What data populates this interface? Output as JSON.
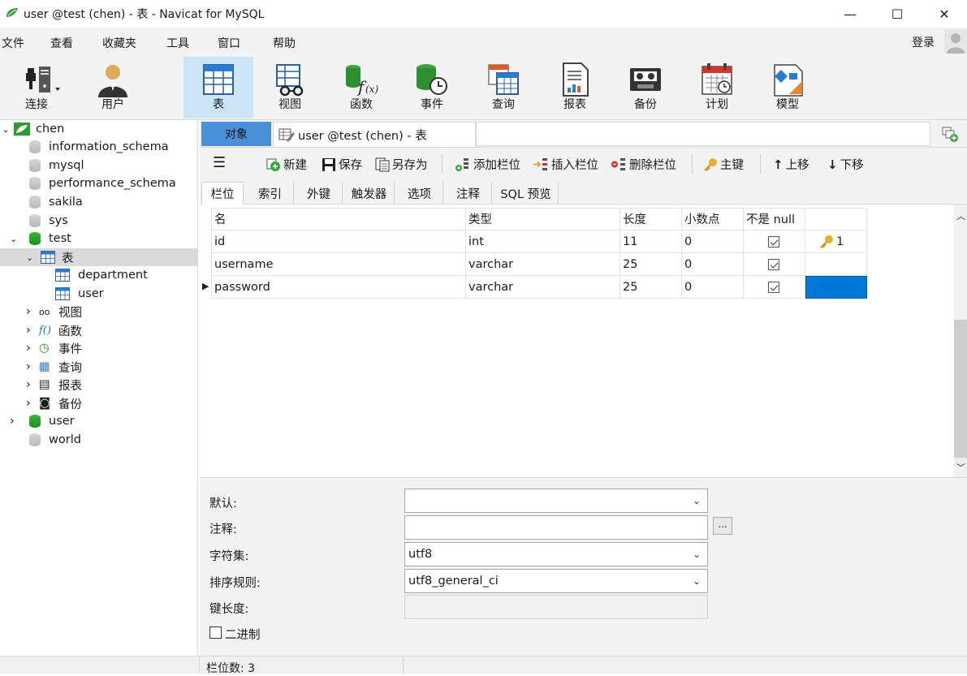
{
  "window": {
    "title": "user @test (chen) - 表 - Navicat for MySQL",
    "minimize_glyph": "—",
    "maximize_glyph": "☐",
    "close_glyph": "✕"
  },
  "menu": {
    "items": [
      "文件",
      "查看",
      "收藏夹",
      "工具",
      "窗口",
      "帮助"
    ],
    "login": "登录"
  },
  "ribbon": {
    "buttons": [
      {
        "label": "连接",
        "icon": "connection-icon"
      },
      {
        "label": "用户",
        "icon": "user-icon"
      },
      {
        "label": "表",
        "icon": "table-icon",
        "active": true
      },
      {
        "label": "视图",
        "icon": "view-icon"
      },
      {
        "label": "函数",
        "icon": "function-icon"
      },
      {
        "label": "事件",
        "icon": "event-icon"
      },
      {
        "label": "查询",
        "icon": "query-icon"
      },
      {
        "label": "报表",
        "icon": "report-icon"
      },
      {
        "label": "备份",
        "icon": "backup-icon"
      },
      {
        "label": "计划",
        "icon": "schedule-icon"
      },
      {
        "label": "模型",
        "icon": "model-icon"
      }
    ]
  },
  "tree": {
    "connection": "chen",
    "databases": [
      "information_schema",
      "mysql",
      "performance_schema",
      "sakila",
      "sys"
    ],
    "test_db": "test",
    "tables_node": "表",
    "tables": [
      "department",
      "user"
    ],
    "categories": [
      "视图",
      "函数",
      "事件",
      "查询",
      "报表",
      "备份"
    ],
    "user_db": "user",
    "world_db": "world"
  },
  "tabs": {
    "objects": "对象",
    "document": "user @test (chen) - 表"
  },
  "toolbar": {
    "new": "新建",
    "save": "保存",
    "save_as": "另存为",
    "add_field": "添加栏位",
    "insert_field": "插入栏位",
    "delete_field": "删除栏位",
    "primary_key": "主键",
    "move_up": "上移",
    "move_down": "下移"
  },
  "subtabs": [
    "栏位",
    "索引",
    "外键",
    "触发器",
    "选项",
    "注释",
    "SQL 预览"
  ],
  "grid": {
    "headers": [
      "名",
      "类型",
      "长度",
      "小数点",
      "不是 null",
      ""
    ],
    "rows": [
      {
        "name": "id",
        "type": "int",
        "length": "11",
        "decimals": "0",
        "not_null": true,
        "key": "1"
      },
      {
        "name": "username",
        "type": "varchar",
        "length": "25",
        "decimals": "0",
        "not_null": true,
        "key": ""
      },
      {
        "name": "password",
        "type": "varchar",
        "length": "25",
        "decimals": "0",
        "not_null": true,
        "key": ""
      }
    ]
  },
  "props": {
    "default_label": "默认:",
    "default_value": "",
    "comment_label": "注释:",
    "comment_value": "",
    "ellipsis": "...",
    "charset_label": "字符集:",
    "charset_value": "utf8",
    "collation_label": "排序规则:",
    "collation_value": "utf8_general_ci",
    "keylen_label": "键长度:",
    "binary_label": "二进制"
  },
  "status": {
    "field_count": "栏位数: 3"
  }
}
